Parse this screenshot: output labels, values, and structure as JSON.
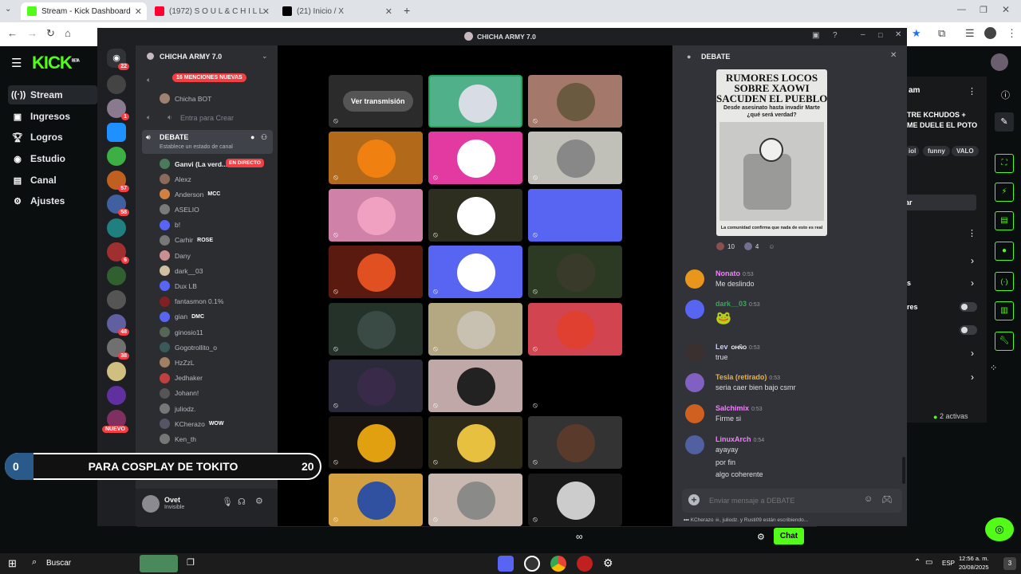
{
  "browser": {
    "tabs": [
      {
        "title": "Stream - Kick Dashboard",
        "color": "#53fc18"
      },
      {
        "title": "(1972) S O U L & C H I L L",
        "color": "#ff0033"
      },
      {
        "title": "(21) Inicio / X",
        "color": "#000000"
      }
    ],
    "new_tab": "+"
  },
  "kick": {
    "logo": "KICK",
    "logo_sup": "BETA",
    "menu": [
      {
        "label": "Stream",
        "icon": "signal-icon"
      },
      {
        "label": "Ingresos",
        "icon": "money-icon"
      },
      {
        "label": "Logros",
        "icon": "trophy-icon"
      },
      {
        "label": "Estudio",
        "icon": "camera-icon"
      },
      {
        "label": "Canal",
        "icon": "channel-icon"
      },
      {
        "label": "Ajustes",
        "icon": "gear-icon"
      }
    ],
    "right_panel": {
      "title_partial": "am",
      "stream_title": "TRE KCHUDOS +\nME DUELE EL POTO",
      "tags": [
        "iol",
        "funny",
        "VALO"
      ],
      "button_partial": "ar",
      "sessions": "2 activas",
      "chat_button": "Chat",
      "partial_labels": [
        "s",
        "res"
      ]
    }
  },
  "discord": {
    "window_title": "CHICHA ARMY 7.0",
    "server_name": "CHICHA ARMY 7.0",
    "mentions_badge": "16 MENCIONES NUEVAS",
    "bot_channel": "Chicha BOT",
    "enter_create": "Entra para Crear",
    "voice_channel": "DEBATE",
    "status_prompt": "Establece un estado de canal",
    "live_user": "Ganvi (La verd...",
    "live_badge": "EN DIRECTO",
    "members": [
      {
        "name": "Alexz",
        "tag": ""
      },
      {
        "name": "Anderson",
        "tag": "MCC"
      },
      {
        "name": "ASELIO",
        "tag": ""
      },
      {
        "name": "b!",
        "tag": ""
      },
      {
        "name": "Carhir",
        "tag": "ROSE"
      },
      {
        "name": "Dany",
        "tag": ""
      },
      {
        "name": "dark__03",
        "tag": ""
      },
      {
        "name": "Dux LB",
        "tag": ""
      },
      {
        "name": "fantasmon 0.1%",
        "tag": ""
      },
      {
        "name": "gian",
        "tag": "DMC"
      },
      {
        "name": "ginosio11",
        "tag": ""
      },
      {
        "name": "Gogotrollito_o",
        "tag": ""
      },
      {
        "name": "HzZzL",
        "tag": ""
      },
      {
        "name": "Jedhaker",
        "tag": ""
      },
      {
        "name": "Johann!",
        "tag": ""
      },
      {
        "name": "juliodz.",
        "tag": ""
      },
      {
        "name": "KCherazo",
        "tag": "WOW"
      },
      {
        "name": "Ken_th",
        "tag": ""
      }
    ],
    "new_badge": "NUEVO",
    "user": {
      "name": "Ovet",
      "status": "Invisible"
    },
    "stage": {
      "watch_button": "Ver transmisión"
    },
    "server_badges": [
      "22",
      "1",
      "57",
      "58",
      "6",
      "48",
      "38"
    ],
    "chat": {
      "title": "DEBATE",
      "meme": {
        "headline": "RUMORES LOCOS\nSOBRE XAOWI\nSACUDEN EL PUEBLO",
        "subhead": "Desde asesinato hasta invadir Marte\n¿qué será verdad?",
        "footer": "La comunidad confirma que nada de esto es real"
      },
      "reactions": [
        "10",
        "4"
      ],
      "messages": [
        {
          "user": "Nonato",
          "time": "0:53",
          "lines": [
            "Me deslindo"
          ],
          "color": "#f47fff"
        },
        {
          "user": "dark__03",
          "time": "0:53",
          "lines": [
            "🐸"
          ],
          "color": "#3ba55d"
        },
        {
          "user": "Lev",
          "tag": "OHÑO",
          "time": "0:53",
          "lines": [
            "true"
          ],
          "color": "#c9cdfb"
        },
        {
          "user": "Tesla (retirado)",
          "time": "0:53",
          "lines": [
            "seria caer bien bajo csmr"
          ],
          "color": "#f0b232"
        },
        {
          "user": "Salchimix",
          "time": "0:53",
          "lines": [
            "Firme si"
          ],
          "color": "#f47fff"
        },
        {
          "user": "LinuxArch",
          "time": "0:54",
          "lines": [
            "ayayay",
            "por fin",
            "algo coherente"
          ],
          "color": "#f47fff"
        }
      ],
      "input_placeholder": "Enviar mensaje a DEBATE",
      "typing": "KCherazo ☠, juliodz. y Rusti09 están escribiendo..."
    }
  },
  "overlay": {
    "left_value": "0",
    "label": "PARA COSPLAY DE TOKITO",
    "right_value": "20"
  },
  "taskbar": {
    "search": "Buscar",
    "lang": "ESP",
    "time": "12:56 a. m.",
    "date": "20/08/2025",
    "notif": "3"
  }
}
